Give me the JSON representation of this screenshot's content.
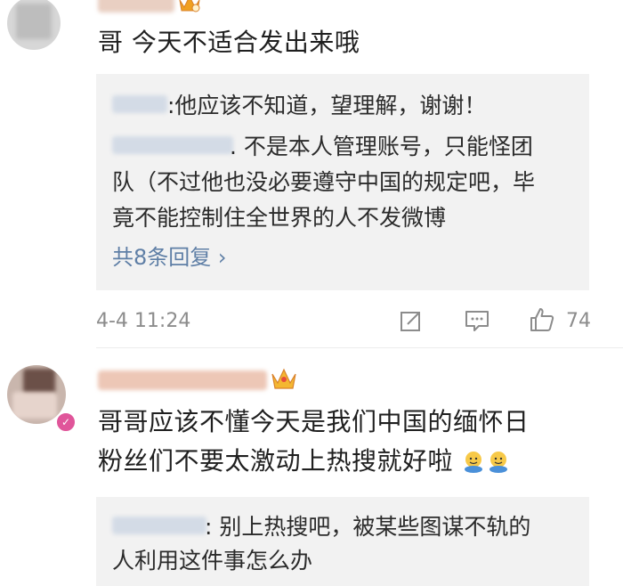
{
  "comments": [
    {
      "text": "哥 今天不适合发出来哦",
      "replies": [
        {
          "line1": ":他应该不知道，望理解，谢谢！"
        },
        {
          "line1": ". 不是本人管理账号，只能怪团",
          "line2": "队（不过他也没必要遵守中国的规定吧，毕",
          "line3": "竟不能控制住全世界的人不发微博"
        }
      ],
      "more_replies": "共8条回复 ›",
      "timestamp": "4-4 11:24",
      "like_count": "74"
    },
    {
      "text_line1": "哥哥应该不懂今天是我们中国的缅怀日",
      "text_line2": "粉丝们不要太激动上热搜就好啦",
      "reply": {
        "line1": ": 别上热搜吧，被某些图谋不轨的",
        "line2": "人利用这件事怎么办"
      }
    }
  ],
  "colors": {
    "link": "#5f7fa6",
    "reply_bg": "#f2f2f2",
    "meta": "#8c8c8c",
    "vip_badge": "#e0559a",
    "crown": "#f0a020"
  }
}
